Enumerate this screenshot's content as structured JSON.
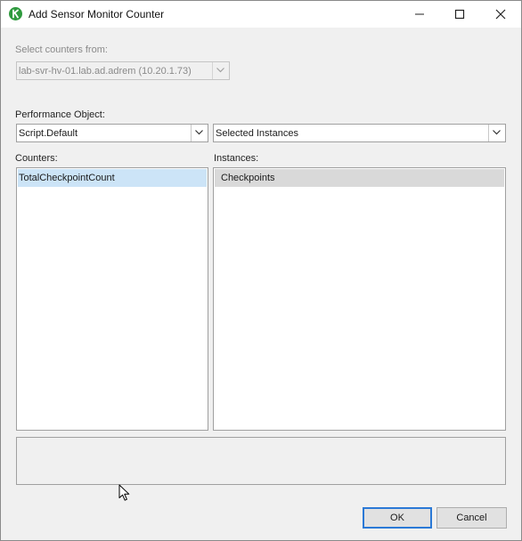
{
  "window": {
    "title": "Add Sensor Monitor Counter",
    "icon": "app-logo-icon",
    "controls": [
      "minimize-icon",
      "maximize-icon",
      "close-icon"
    ]
  },
  "source": {
    "label": "Select counters from:",
    "value": "lab-svr-hv-01.lab.ad.adrem (10.20.1.73)",
    "enabled": false
  },
  "performance_object": {
    "label": "Performance Object:",
    "value": "Script.Default"
  },
  "instance_filter": {
    "value": "Selected Instances"
  },
  "counters": {
    "label": "Counters:",
    "items": [
      "TotalCheckpointCount"
    ],
    "selected": "TotalCheckpointCount"
  },
  "instances": {
    "label": "Instances:",
    "items": [
      "Checkpoints"
    ],
    "selected": "Checkpoints"
  },
  "buttons": {
    "ok": "OK",
    "cancel": "Cancel"
  },
  "colors": {
    "selection": "#cce4f7",
    "inactive_selection": "#d9d9d9",
    "default_button_border": "#2b79d6",
    "app_icon": "#2f9a3e"
  }
}
